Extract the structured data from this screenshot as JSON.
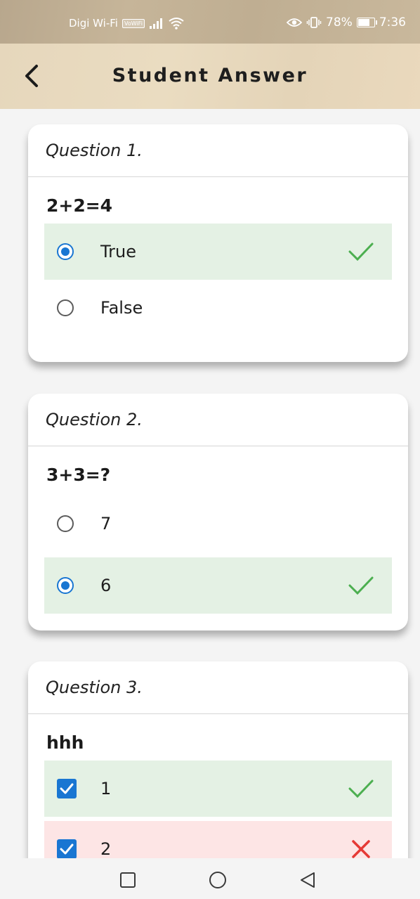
{
  "status_bar": {
    "carrier": "Digi Wi-Fi",
    "vowifi": "VoWiFi",
    "battery": "78%",
    "time": "7:36"
  },
  "header": {
    "title": "Student Answer"
  },
  "questions": [
    {
      "label": "Question 1.",
      "text": "2+2=4",
      "type": "radio",
      "options": [
        {
          "label": "True",
          "selected": true,
          "status": "correct"
        },
        {
          "label": "False",
          "selected": false,
          "status": "none"
        }
      ]
    },
    {
      "label": "Question 2.",
      "text": "3+3=?",
      "type": "radio",
      "options": [
        {
          "label": "7",
          "selected": false,
          "status": "none"
        },
        {
          "label": "6",
          "selected": true,
          "status": "correct"
        }
      ]
    },
    {
      "label": "Question 3.",
      "text": "hhh",
      "type": "checkbox",
      "options": [
        {
          "label": "1",
          "selected": true,
          "status": "correct"
        },
        {
          "label": "2",
          "selected": true,
          "status": "wrong"
        }
      ]
    }
  ],
  "colors": {
    "accent": "#1976d2",
    "correct_bg": "#e4f1e4",
    "wrong_bg": "#fde5e5",
    "check_mark": "#4caf50",
    "cross_mark": "#e53935"
  },
  "icons": {
    "back": "back-arrow-icon",
    "correct": "check-mark-icon",
    "wrong": "cross-icon",
    "nav_recent": "square-icon",
    "nav_home": "circle-icon",
    "nav_back": "triangle-back-icon"
  }
}
